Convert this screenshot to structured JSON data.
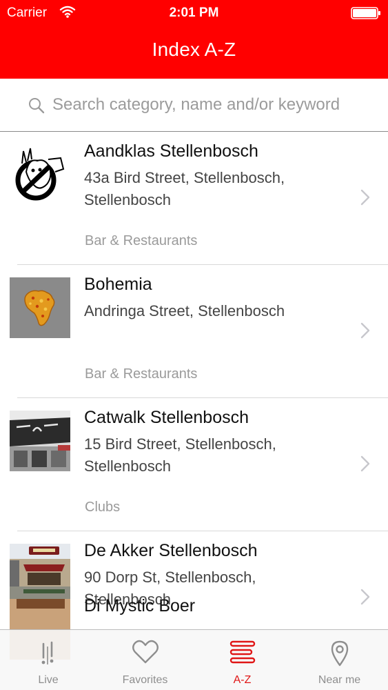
{
  "status_bar": {
    "carrier": "Carrier",
    "time": "2:01 PM"
  },
  "header": {
    "title": "Index A-Z",
    "background_color": "#ff0000"
  },
  "search": {
    "placeholder": "Search category, name and/or keyword",
    "value": ""
  },
  "listings": [
    {
      "name": "Aandklas Stellenbosch",
      "address": "43a Bird Street, Stellenbosch, Stellenbosch",
      "category": "Bar & Restaurants",
      "image": "ghostbusters-logo"
    },
    {
      "name": "Bohemia",
      "address": "Andringa Street, Stellenbosch",
      "category": "Bar & Restaurants",
      "image": "africa-map-logo"
    },
    {
      "name": "Catwalk Stellenbosch",
      "address": "15 Bird Street, Stellenbosch, Stellenbosch",
      "category": "Clubs",
      "image": "catwalk-storefront-photo"
    },
    {
      "name": "De Akker Stellenbosch",
      "address": "90 Dorp St, Stellenbosch, Stellenbosch",
      "category": "",
      "image": "de-akker-storefront-photo"
    },
    {
      "name": "Di Mystic Boer",
      "address": "",
      "category": "",
      "image": "partial-thumbnail"
    }
  ],
  "tab_bar": {
    "tabs": [
      {
        "label": "Live",
        "icon": "live-icon",
        "active": false
      },
      {
        "label": "Favorites",
        "icon": "heart-icon",
        "active": false
      },
      {
        "label": "A-Z",
        "icon": "a-z-list-icon",
        "active": true
      },
      {
        "label": "Near me",
        "icon": "location-pin-icon",
        "active": false
      }
    ],
    "active_color": "#e01616"
  }
}
